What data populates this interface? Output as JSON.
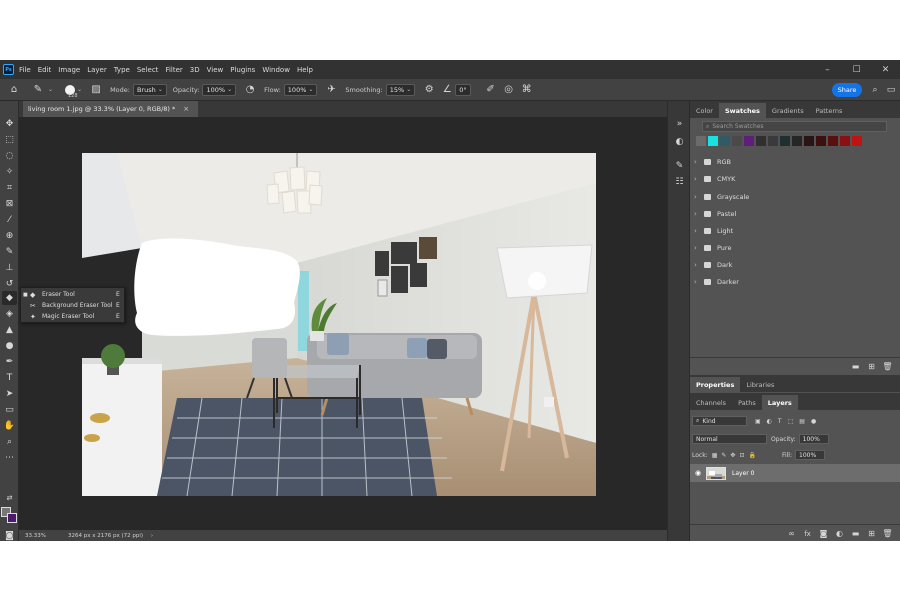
{
  "app": {
    "logo": "Ps",
    "window_controls": [
      "–",
      "☐",
      "✕"
    ]
  },
  "menu": [
    "File",
    "Edit",
    "Image",
    "Layer",
    "Type",
    "Select",
    "Filter",
    "3D",
    "View",
    "Plugins",
    "Window",
    "Help"
  ],
  "options": {
    "brush_size": "128",
    "mode_label": "Mode:",
    "mode_value": "Brush",
    "opacity_label": "Opacity:",
    "opacity_value": "100%",
    "flow_label": "Flow:",
    "flow_value": "100%",
    "smoothing_label": "Smoothing:",
    "smoothing_value": "15%",
    "angle_value": "0°",
    "share_label": "Share"
  },
  "document": {
    "tab_title": "living room 1.jpg @ 33.3% (Layer 0, RGB/8) *",
    "close": "×"
  },
  "status": {
    "zoom": "33.33%",
    "dims": "3264 px x 2176 px (72 ppi)",
    "arrow": "›"
  },
  "flyout": [
    {
      "icon": "eraser-icon",
      "label": "Eraser Tool",
      "key": "E",
      "marker": "■"
    },
    {
      "icon": "background-eraser-icon",
      "label": "Background Eraser Tool",
      "key": "E",
      "marker": ""
    },
    {
      "icon": "magic-eraser-icon",
      "label": "Magic Eraser Tool",
      "key": "E",
      "marker": ""
    }
  ],
  "swatches": {
    "tabs": [
      "Color",
      "Swatches",
      "Gradients",
      "Patterns"
    ],
    "active": "Swatches",
    "search_placeholder": "Search Swatches",
    "recent_colors": [
      "#6b6b6b",
      "#19e1e1",
      "#2e5b66",
      "#4a4a4a",
      "#5e1e7a",
      "#303030",
      "#3a3a3a",
      "#1f3030",
      "#262626",
      "#2b1414",
      "#3a1010",
      "#5a0f0f",
      "#8b1010",
      "#c01414"
    ],
    "groups": [
      "RGB",
      "CMYK",
      "Grayscale",
      "Pastel",
      "Light",
      "Pure",
      "Dark",
      "Darker"
    ]
  },
  "properties": {
    "tabs": [
      "Properties",
      "Libraries"
    ]
  },
  "layers": {
    "tabs": [
      "Channels",
      "Paths",
      "Layers"
    ],
    "active": "Layers",
    "filter_kind": "Kind",
    "blend_mode": "Normal",
    "opacity_label": "Opacity:",
    "opacity_value": "100%",
    "lock_label": "Lock:",
    "fill_label": "Fill:",
    "fill_value": "100%",
    "layer_name": "Layer 0",
    "footer_fx": "fx"
  },
  "colors": {
    "accent": "#1473e6",
    "foreground": "#777777",
    "background": "#4b1a6b"
  }
}
